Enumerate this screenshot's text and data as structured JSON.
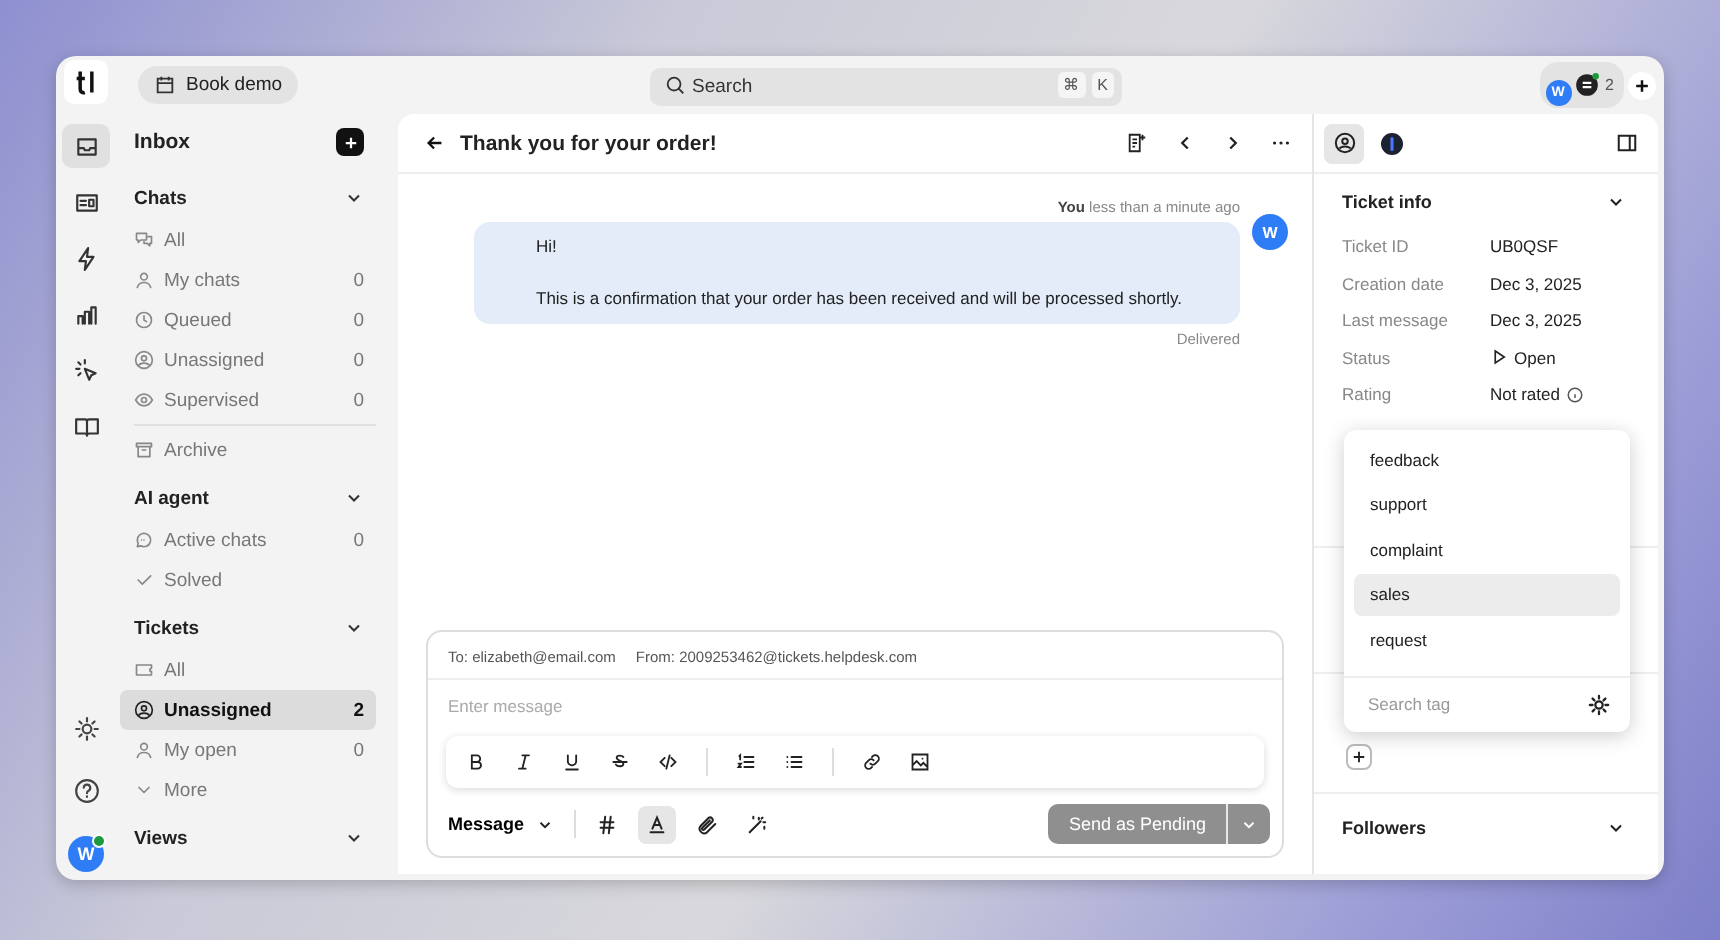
{
  "topbar": {
    "book_demo": "Book demo",
    "search": {
      "placeholder": "Search",
      "keys": [
        "⌘",
        "K"
      ]
    },
    "agents": {
      "avatar": "W",
      "count": "2"
    }
  },
  "rail": {
    "items": [
      {
        "kind": "inbox",
        "selected": true
      },
      {
        "kind": "contacts",
        "selected": false
      },
      {
        "kind": "automation",
        "selected": false
      },
      {
        "kind": "reports",
        "selected": false
      },
      {
        "kind": "ai",
        "selected": false
      },
      {
        "kind": "knowledge",
        "selected": false
      }
    ],
    "avatar": "W",
    "online": true
  },
  "sidebar": {
    "title": "Inbox",
    "sections": [
      {
        "title": "Chats",
        "expanded": true,
        "items": [
          {
            "kind": "chats",
            "label": "All",
            "selected": false
          },
          {
            "kind": "person",
            "label": "My chats",
            "count": "0",
            "selected": false
          },
          {
            "kind": "clock",
            "label": "Queued",
            "count": "0",
            "selected": false
          },
          {
            "kind": "person-circle",
            "label": "Unassigned",
            "count": "0",
            "selected": false
          },
          {
            "kind": "eye",
            "label": "Supervised",
            "count": "0",
            "selected": false
          },
          {
            "kind": "archive",
            "label": "Archive",
            "selected": false
          }
        ]
      },
      {
        "title": "AI agent",
        "expanded": true,
        "items": [
          {
            "kind": "bubble",
            "label": "Active chats",
            "count": "0",
            "selected": false
          },
          {
            "kind": "check",
            "label": "Solved",
            "selected": false
          }
        ]
      },
      {
        "title": "Tickets",
        "expanded": true,
        "items": [
          {
            "kind": "ticket",
            "label": "All",
            "selected": false
          },
          {
            "kind": "person-circle",
            "label": "Unassigned",
            "count": "2",
            "selected": true
          },
          {
            "kind": "person",
            "label": "My open",
            "count": "0",
            "selected": false
          },
          {
            "kind": "more",
            "label": "More",
            "selected": false
          }
        ]
      },
      {
        "title": "Views",
        "expanded": true
      }
    ]
  },
  "conversation": {
    "title": "Thank you for your order!",
    "message": {
      "author": "You",
      "time": "less than a minute ago",
      "avatar": "W",
      "lines": [
        "Hi!",
        "This is a confirmation that your order has been received and will be processed shortly."
      ],
      "status": "Delivered"
    },
    "composer": {
      "to": "To: elizabeth@email.com",
      "from": "From: 2009253462@tickets.helpdesk.com",
      "placeholder": "Enter message",
      "format_tools": [
        {
          "kind": "bold"
        },
        {
          "kind": "italic"
        },
        {
          "kind": "underline"
        },
        {
          "kind": "strike"
        },
        {
          "kind": "code"
        },
        {
          "kind": "ordered"
        },
        {
          "kind": "bullets"
        },
        {
          "kind": "link"
        },
        {
          "kind": "image"
        }
      ],
      "mode": "Message",
      "tools": [
        {
          "kind": "hash",
          "selected": false
        },
        {
          "kind": "textcolor",
          "selected": true
        },
        {
          "kind": "attach",
          "selected": false
        },
        {
          "kind": "magic",
          "selected": false
        }
      ],
      "send": {
        "label": "Send as Pending",
        "disabled": true
      }
    }
  },
  "details": {
    "tabs": [
      {
        "kind": "customer",
        "selected": true
      },
      {
        "kind": "ai",
        "selected": false
      }
    ],
    "ticket_info": {
      "title": "Ticket info",
      "expanded": true,
      "fields": [
        {
          "label": "Ticket ID",
          "value": "UB0QSF"
        },
        {
          "label": "Creation date",
          "value": "Dec 3, 2025"
        },
        {
          "label": "Last message",
          "value": "Dec 3, 2025"
        },
        {
          "label": "Status",
          "value": "Open",
          "kind": "status"
        },
        {
          "label": "Rating",
          "value": "Not rated",
          "kind": "rating"
        }
      ]
    },
    "tag_menu": {
      "options": [
        {
          "label": "feedback",
          "selected": false
        },
        {
          "label": "support",
          "selected": false
        },
        {
          "label": "complaint",
          "selected": false
        },
        {
          "label": "sales",
          "selected": true
        },
        {
          "label": "request",
          "selected": false
        }
      ],
      "placeholder": "Search tag"
    },
    "followers": {
      "title": "Followers",
      "expanded": false
    }
  }
}
